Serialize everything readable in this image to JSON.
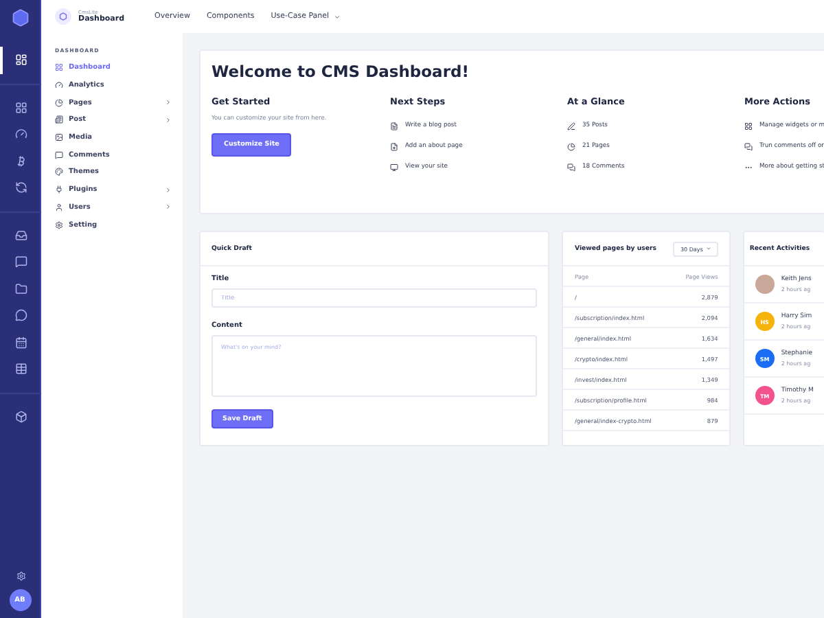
{
  "rail": {
    "items": [
      {
        "selected": true
      },
      {
        "selected": false
      },
      {
        "selected": false
      },
      {
        "selected": false
      },
      {
        "selected": false
      },
      {
        "selected": false
      },
      {
        "selected": false
      },
      {
        "selected": false
      },
      {
        "selected": false
      },
      {
        "selected": false
      },
      {
        "selected": false
      },
      {
        "selected": false
      }
    ],
    "avatar": "AB"
  },
  "header": {
    "brand_small": "CmsLite",
    "brand": "Dashboard",
    "nav": [
      {
        "label": "Overview",
        "dropdown": false
      },
      {
        "label": "Components",
        "dropdown": false
      },
      {
        "label": "Use-Case Panel",
        "dropdown": true
      }
    ]
  },
  "sidebar": {
    "heading": "DASHBOARD",
    "items": [
      {
        "label": "Dashboard",
        "selected": true,
        "expandable": false
      },
      {
        "label": "Analytics",
        "selected": false,
        "expandable": false
      },
      {
        "label": "Pages",
        "selected": false,
        "expandable": true
      },
      {
        "label": "Post",
        "selected": false,
        "expandable": true
      },
      {
        "label": "Media",
        "selected": false,
        "expandable": false
      },
      {
        "label": "Comments",
        "selected": false,
        "expandable": false
      },
      {
        "label": "Themes",
        "selected": false,
        "expandable": false
      },
      {
        "label": "Plugins",
        "selected": false,
        "expandable": true
      },
      {
        "label": "Users",
        "selected": false,
        "expandable": true
      },
      {
        "label": "Setting",
        "selected": false,
        "expandable": false
      }
    ]
  },
  "welcome": {
    "title": "Welcome to CMS Dashboard!",
    "get_started": {
      "heading": "Get Started",
      "text": "You can customize your site from here.",
      "button": "Customize Site"
    },
    "columns": [
      {
        "heading": "Next Steps",
        "links": [
          "Write a blog post",
          "Add an about page",
          "View your site"
        ]
      },
      {
        "heading": "At a Glance",
        "links": [
          "35 Posts",
          "21 Pages",
          "18 Comments"
        ]
      },
      {
        "heading": "More Actions",
        "links": [
          "Manage widgets or m",
          "Trun comments off or",
          "More about getting st"
        ]
      }
    ]
  },
  "quick_draft": {
    "title": "Quick Draft",
    "title_label": "Title",
    "title_placeholder": "Title",
    "content_label": "Content",
    "content_placeholder": "What's on your mind?",
    "button": "Save Draft"
  },
  "viewed_pages": {
    "title": "Viewed pages by users",
    "range": "30 Days",
    "columns": [
      "Page",
      "Page Views"
    ],
    "rows": [
      [
        "/",
        "2,879"
      ],
      [
        "/subscription/index.html",
        "2,094"
      ],
      [
        "/general/index.html",
        "1,634"
      ],
      [
        "/crypto/index.html",
        "1,497"
      ],
      [
        "/invest/index.html",
        "1,349"
      ],
      [
        "/subscription/profile.html",
        "984"
      ],
      [
        "/general/index-crypto.html",
        "879"
      ]
    ]
  },
  "recent_activities": {
    "title": "Recent Activities",
    "items": [
      {
        "kind": "photo",
        "name": "Keith Jens",
        "time": "2 hours ag"
      },
      {
        "kind": "initials",
        "initials": "HS",
        "color": "#f5b40b",
        "name": "Harry Sim",
        "time": "2 hours ag"
      },
      {
        "kind": "initials",
        "initials": "SM",
        "color": "#1b6ef3",
        "name": "Stephanie",
        "time": "2 hours ag"
      },
      {
        "kind": "initials",
        "initials": "TM",
        "color": "#f2538d",
        "name": "Timothy M",
        "time": "2 hours ag"
      }
    ]
  }
}
